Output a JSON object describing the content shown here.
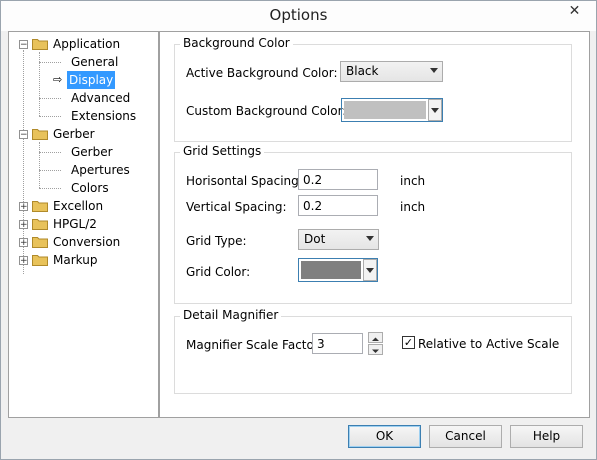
{
  "window": {
    "title": "Options",
    "close_glyph": "✕"
  },
  "tree": {
    "items": [
      {
        "label": "Application",
        "level": 0,
        "expanded": true
      },
      {
        "label": "General",
        "level": 1
      },
      {
        "label": "Display",
        "level": 1,
        "selected": true
      },
      {
        "label": "Advanced",
        "level": 1
      },
      {
        "label": "Extensions",
        "level": 1
      },
      {
        "label": "Gerber",
        "level": 0,
        "expanded": true
      },
      {
        "label": "Gerber",
        "level": 1
      },
      {
        "label": "Apertures",
        "level": 1
      },
      {
        "label": "Colors",
        "level": 1
      },
      {
        "label": "Excellon",
        "level": 0,
        "expanded": false
      },
      {
        "label": "HPGL/2",
        "level": 0,
        "expanded": false
      },
      {
        "label": "Conversion",
        "level": 0,
        "expanded": false
      },
      {
        "label": "Markup",
        "level": 0,
        "expanded": false
      }
    ]
  },
  "background": {
    "legend": "Background Color",
    "active_label": "Active Background Color:",
    "active_value": "Black",
    "custom_label": "Custom Background Color:",
    "custom_color": "#c0c0c0"
  },
  "grid": {
    "legend": "Grid Settings",
    "h_label": "Horisontal Spacing:",
    "h_value": "0.2",
    "h_unit": "inch",
    "v_label": "Vertical Spacing:",
    "v_value": "0.2",
    "v_unit": "inch",
    "type_label": "Grid Type:",
    "type_value": "Dot",
    "color_label": "Grid Color:",
    "color": "#808080"
  },
  "magnifier": {
    "legend": "Detail Magnifier",
    "scale_label": "Magnifier Scale Factor:",
    "scale_value": "3",
    "relative_label": "Relative to Active Scale",
    "relative_checked": true
  },
  "buttons": {
    "ok": "OK",
    "cancel": "Cancel",
    "help": "Help"
  },
  "colors": {
    "selection": "#3399ff",
    "folder": "#e8c25a"
  }
}
